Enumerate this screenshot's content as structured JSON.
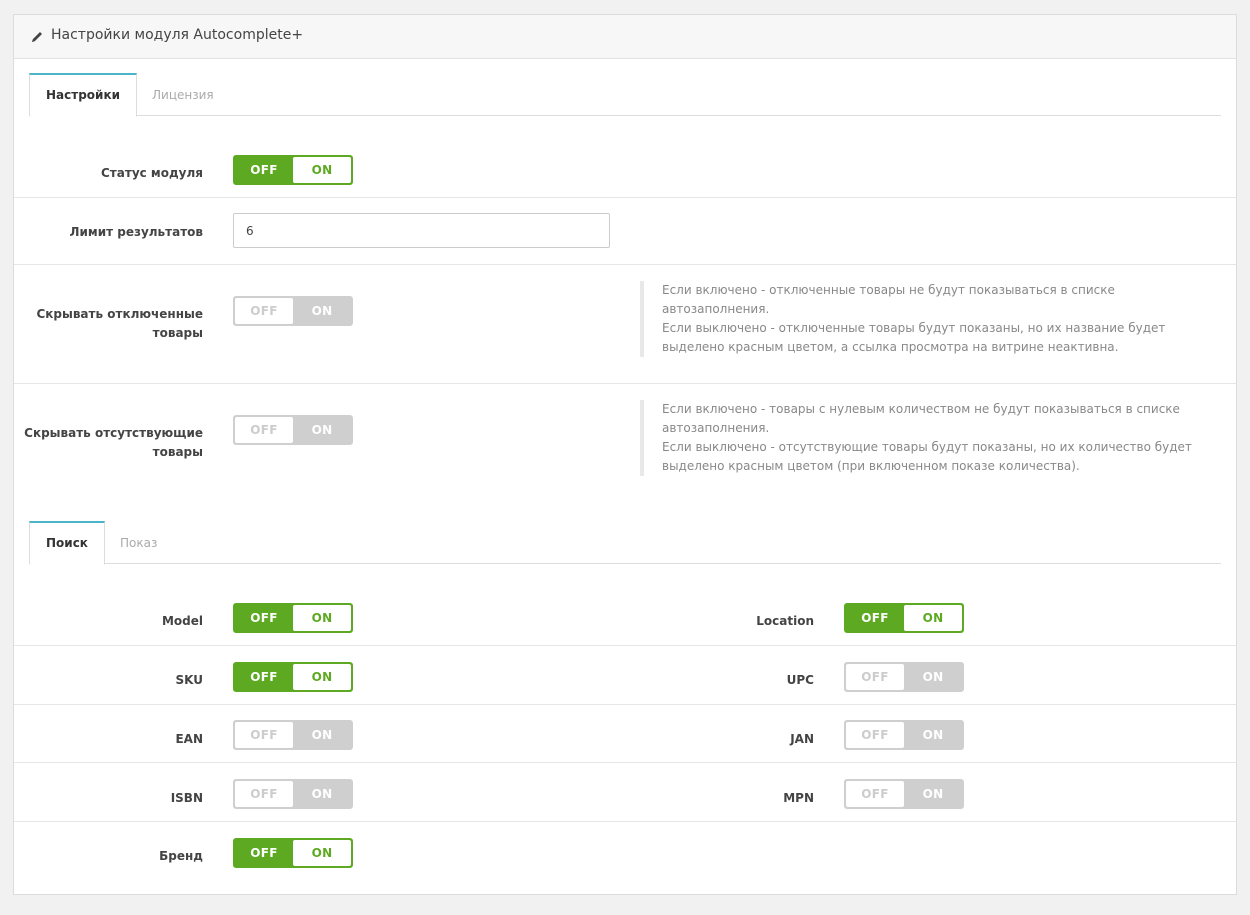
{
  "panel": {
    "title": "Настройки модуля Autocomplete+"
  },
  "tabs_main": [
    {
      "label": "Настройки",
      "active": true
    },
    {
      "label": "Лицензия",
      "active": false
    }
  ],
  "settings": {
    "status": {
      "label": "Статус модуля",
      "off": "OFF",
      "on": "ON",
      "value": true
    },
    "limit": {
      "label": "Лимит результатов",
      "value": "6"
    },
    "hide_disabled": {
      "label": "Скрывать отключенные товары",
      "off": "OFF",
      "on": "ON",
      "value": false,
      "help": [
        "Если включено - отключенные товары не будут показываться в списке автозаполнения.",
        "Если выключено - отключенные товары будут показаны, но их название будет выделено красным цветом, а ссылка просмотра на витрине неактивна."
      ]
    },
    "hide_missing": {
      "label": "Скрывать отсутствующие товары",
      "off": "OFF",
      "on": "ON",
      "value": false,
      "help": [
        "Если включено - товары с нулевым количеством не будут показываться в списке автозаполнения.",
        "Если выключено - отсутствующие товары будут показаны, но их количество будет выделено красным цветом (при включенном показе количества)."
      ]
    }
  },
  "tabs_search": [
    {
      "label": "Поиск",
      "active": true
    },
    {
      "label": "Показ",
      "active": false
    }
  ],
  "search_fields": [
    {
      "left": {
        "label": "Model",
        "value": true
      },
      "right": {
        "label": "Location",
        "value": true
      }
    },
    {
      "left": {
        "label": "SKU",
        "value": true
      },
      "right": {
        "label": "UPC",
        "value": false
      }
    },
    {
      "left": {
        "label": "EAN",
        "value": false
      },
      "right": {
        "label": "JAN",
        "value": false
      }
    },
    {
      "left": {
        "label": "ISBN",
        "value": false
      },
      "right": {
        "label": "MPN",
        "value": false
      }
    },
    {
      "left": {
        "label": "Бренд",
        "value": true
      }
    }
  ],
  "toggle_text": {
    "off": "OFF",
    "on": "ON"
  },
  "colors": {
    "accent_green": "#5daa22",
    "tab_accent": "#4cb4c8",
    "toggle_off": "#cfcfcf"
  }
}
